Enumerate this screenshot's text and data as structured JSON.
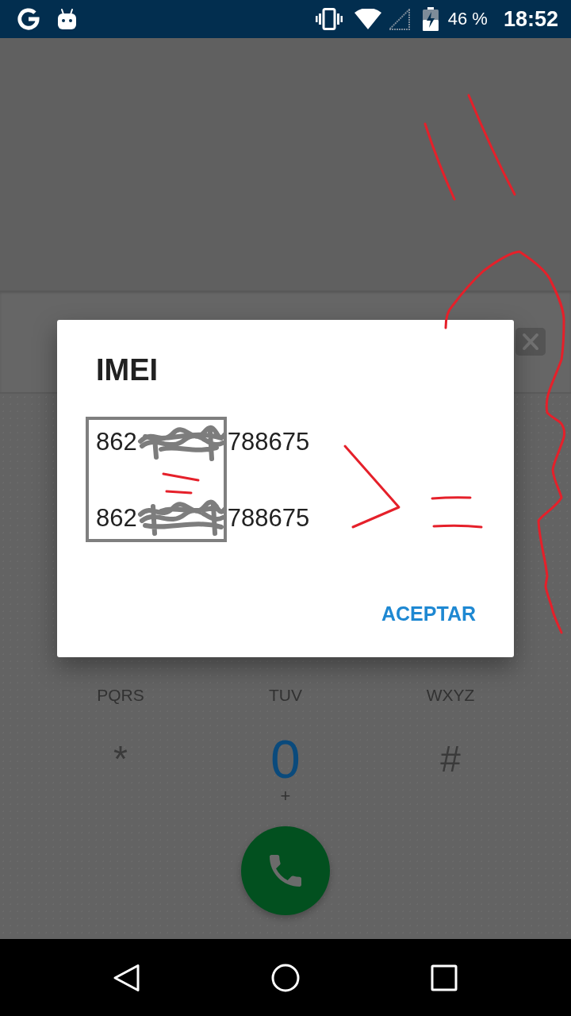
{
  "status_bar": {
    "battery": "46 %",
    "time": "18:52"
  },
  "dialer": {
    "keys": [
      {
        "sublabel": "PQRS"
      },
      {
        "sublabel": "TUV"
      },
      {
        "sublabel": "WXYZ"
      },
      {
        "label": "*",
        "kind": "symbol"
      },
      {
        "label": "0",
        "kind": "number",
        "sublabel": "+"
      },
      {
        "label": "#",
        "kind": "symbol"
      }
    ]
  },
  "dialog": {
    "title": "IMEI",
    "imei_numbers": [
      {
        "visible_start": "862",
        "visible_end": "788675"
      },
      {
        "visible_start": "862",
        "visible_end": "788675"
      }
    ],
    "buttons": [
      "ACEPTAR"
    ]
  }
}
